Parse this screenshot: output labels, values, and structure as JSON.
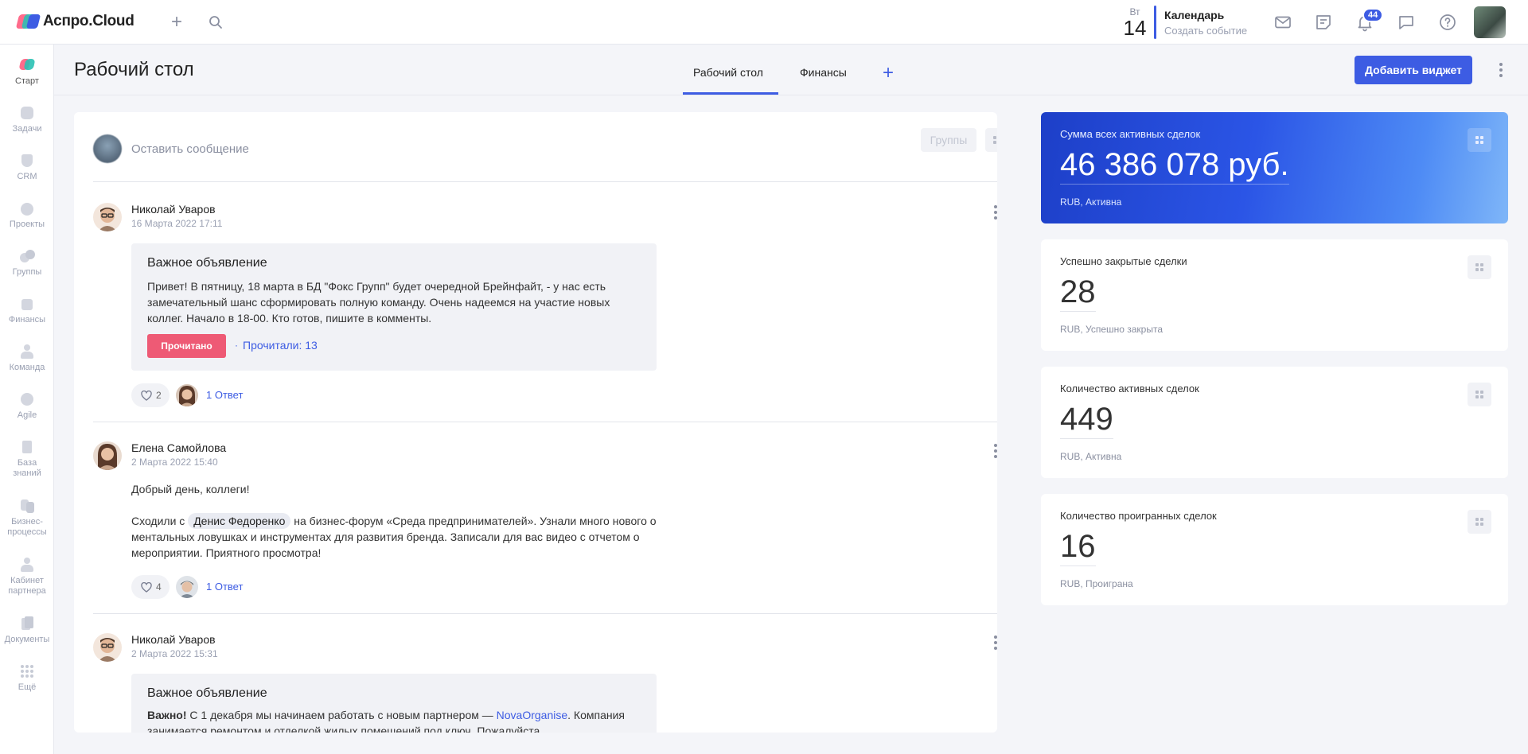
{
  "app": {
    "logo_text": "Аспро.Cloud"
  },
  "topbar": {
    "calendar": {
      "dow": "Вт",
      "day": "14",
      "title": "Календарь",
      "subtitle": "Создать событие"
    },
    "notifications_badge": "44"
  },
  "sidebar": {
    "items": [
      {
        "label": "Старт",
        "icon": "start-icon"
      },
      {
        "label": "Задачи",
        "icon": "tasks-icon"
      },
      {
        "label": "CRM",
        "icon": "crm-icon"
      },
      {
        "label": "Проекты",
        "icon": "projects-icon"
      },
      {
        "label": "Группы",
        "icon": "groups-icon"
      },
      {
        "label": "Финансы",
        "icon": "finance-icon"
      },
      {
        "label": "Команда",
        "icon": "team-icon"
      },
      {
        "label": "Agile",
        "icon": "agile-icon"
      },
      {
        "label": "База знаний",
        "icon": "knowledge-icon"
      },
      {
        "label": "Бизнес-процессы",
        "icon": "bizproc-icon"
      },
      {
        "label": "Кабинет партнера",
        "icon": "partner-icon"
      },
      {
        "label": "Документы",
        "icon": "documents-icon"
      },
      {
        "label": "Ещё",
        "icon": "more-icon"
      }
    ]
  },
  "page": {
    "title": "Рабочий стол",
    "tabs": [
      {
        "label": "Рабочий стол"
      },
      {
        "label": "Финансы"
      }
    ],
    "add_widget": "Добавить виджет"
  },
  "feed": {
    "composer_placeholder": "Оставить сообщение",
    "groups_label": "Группы",
    "posts": [
      {
        "author": "Николай Уваров",
        "date": "16 Марта 2022 17:11",
        "notice_title": "Важное объявление",
        "notice_text": "Привет! В пятницу, 18 марта в БД \"Фокс Групп\" будет очередной Брейнфайт, - у нас есть замечательный шанс сформировать полную команду. Очень надеемся на участие новых коллег. Начало в 18-00. Кто готов, пишите в комменты.",
        "read_button": "Прочитано",
        "read_count": "Прочитали: 13",
        "likes": "2",
        "replies": "1 Ответ"
      },
      {
        "author": "Елена Самойлова",
        "date": "2 Марта 2022 15:40",
        "greeting": "Добрый день, коллеги!",
        "text_before": "Сходили с ",
        "mention": "Денис Федоренко",
        "text_after": " на бизнес-форум «Среда предпринимателей». Узнали много нового о ментальных ловушках и инструментах для развития бренда. Записали для вас видео с отчетом о мероприятии. Приятного просмотра!",
        "likes": "4",
        "replies": "1 Ответ"
      },
      {
        "author": "Николай Уваров",
        "date": "2 Марта 2022 15:31",
        "notice_title": "Важное объявление",
        "strong": "Важно!",
        "text_before": " С 1 декабря мы начинаем работать с новым партнером — ",
        "link": "NovaOrganise",
        "text_after": ". Компания занимается ремонтом и отделкой жилых помещений под ключ. Пожалуйста"
      }
    ]
  },
  "widgets": [
    {
      "label": "Сумма всех активных сделок",
      "value": "46 386 078 руб.",
      "sub": "RUB, Активна"
    },
    {
      "label": "Успешно закрытые сделки",
      "value": "28",
      "sub": "RUB, Успешно закрыта"
    },
    {
      "label": "Количество активных сделок",
      "value": "449",
      "sub": "RUB, Активна"
    },
    {
      "label": "Количество проигранных сделок",
      "value": "16",
      "sub": "RUB, Проиграна"
    }
  ],
  "colors": {
    "accent": "#3d5ce3",
    "danger": "#ee5a75",
    "background": "#f4f5f9"
  }
}
